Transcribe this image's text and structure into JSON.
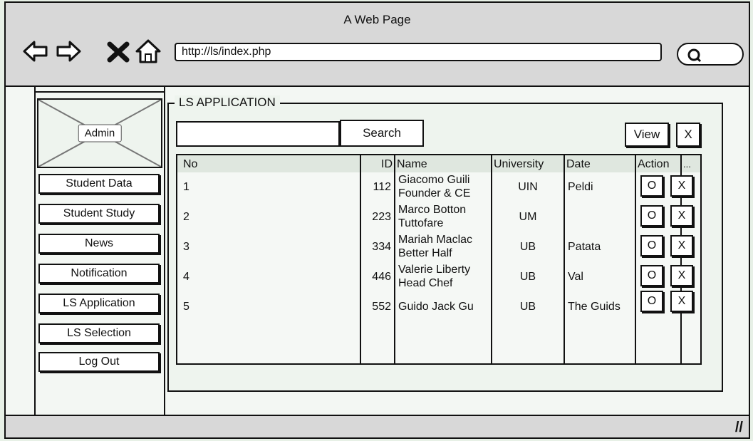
{
  "browser": {
    "title": "A Web Page",
    "url": "http://ls/index.php"
  },
  "sidebar": {
    "admin_label": "Admin",
    "items": [
      {
        "label": "Student Data"
      },
      {
        "label": "Student Study"
      },
      {
        "label": "News"
      },
      {
        "label": "Notification"
      },
      {
        "label": "LS Application"
      },
      {
        "label": "LS Selection"
      },
      {
        "label": "Log Out"
      }
    ]
  },
  "main": {
    "title": "LS APPLICATION",
    "search_label": "Search",
    "view_label": "View",
    "close_label": "X"
  },
  "table": {
    "headers": {
      "no": "No",
      "id": "ID",
      "name": "Name",
      "university": "University",
      "date": "Date",
      "action": "Action",
      "extra": "..."
    },
    "rows": [
      {
        "no": "1",
        "id": "112",
        "name1": "Giacomo Guili",
        "name2": "Founder & CE",
        "university": "UIN",
        "date": "Peldi",
        "open": "O",
        "del": "X"
      },
      {
        "no": "2",
        "id": "223",
        "name1": "Marco Botton",
        "name2": "Tuttofare",
        "university": "UM",
        "date": "",
        "open": "O",
        "del": "X"
      },
      {
        "no": "3",
        "id": "334",
        "name1": "Mariah Maclac",
        "name2": "Better Half",
        "university": "UB",
        "date": "Patata",
        "open": "O",
        "del": "X"
      },
      {
        "no": "4",
        "id": "446",
        "name1": "Valerie Liberty",
        "name2": "Head Chef",
        "university": "UB",
        "date": "Val",
        "open": "O",
        "del": "X"
      },
      {
        "no": "5",
        "id": "552",
        "name1": "Guido Jack Gu",
        "name2": "",
        "university": "UB",
        "date": "The Guids",
        "open": "O",
        "del": "X"
      }
    ]
  }
}
